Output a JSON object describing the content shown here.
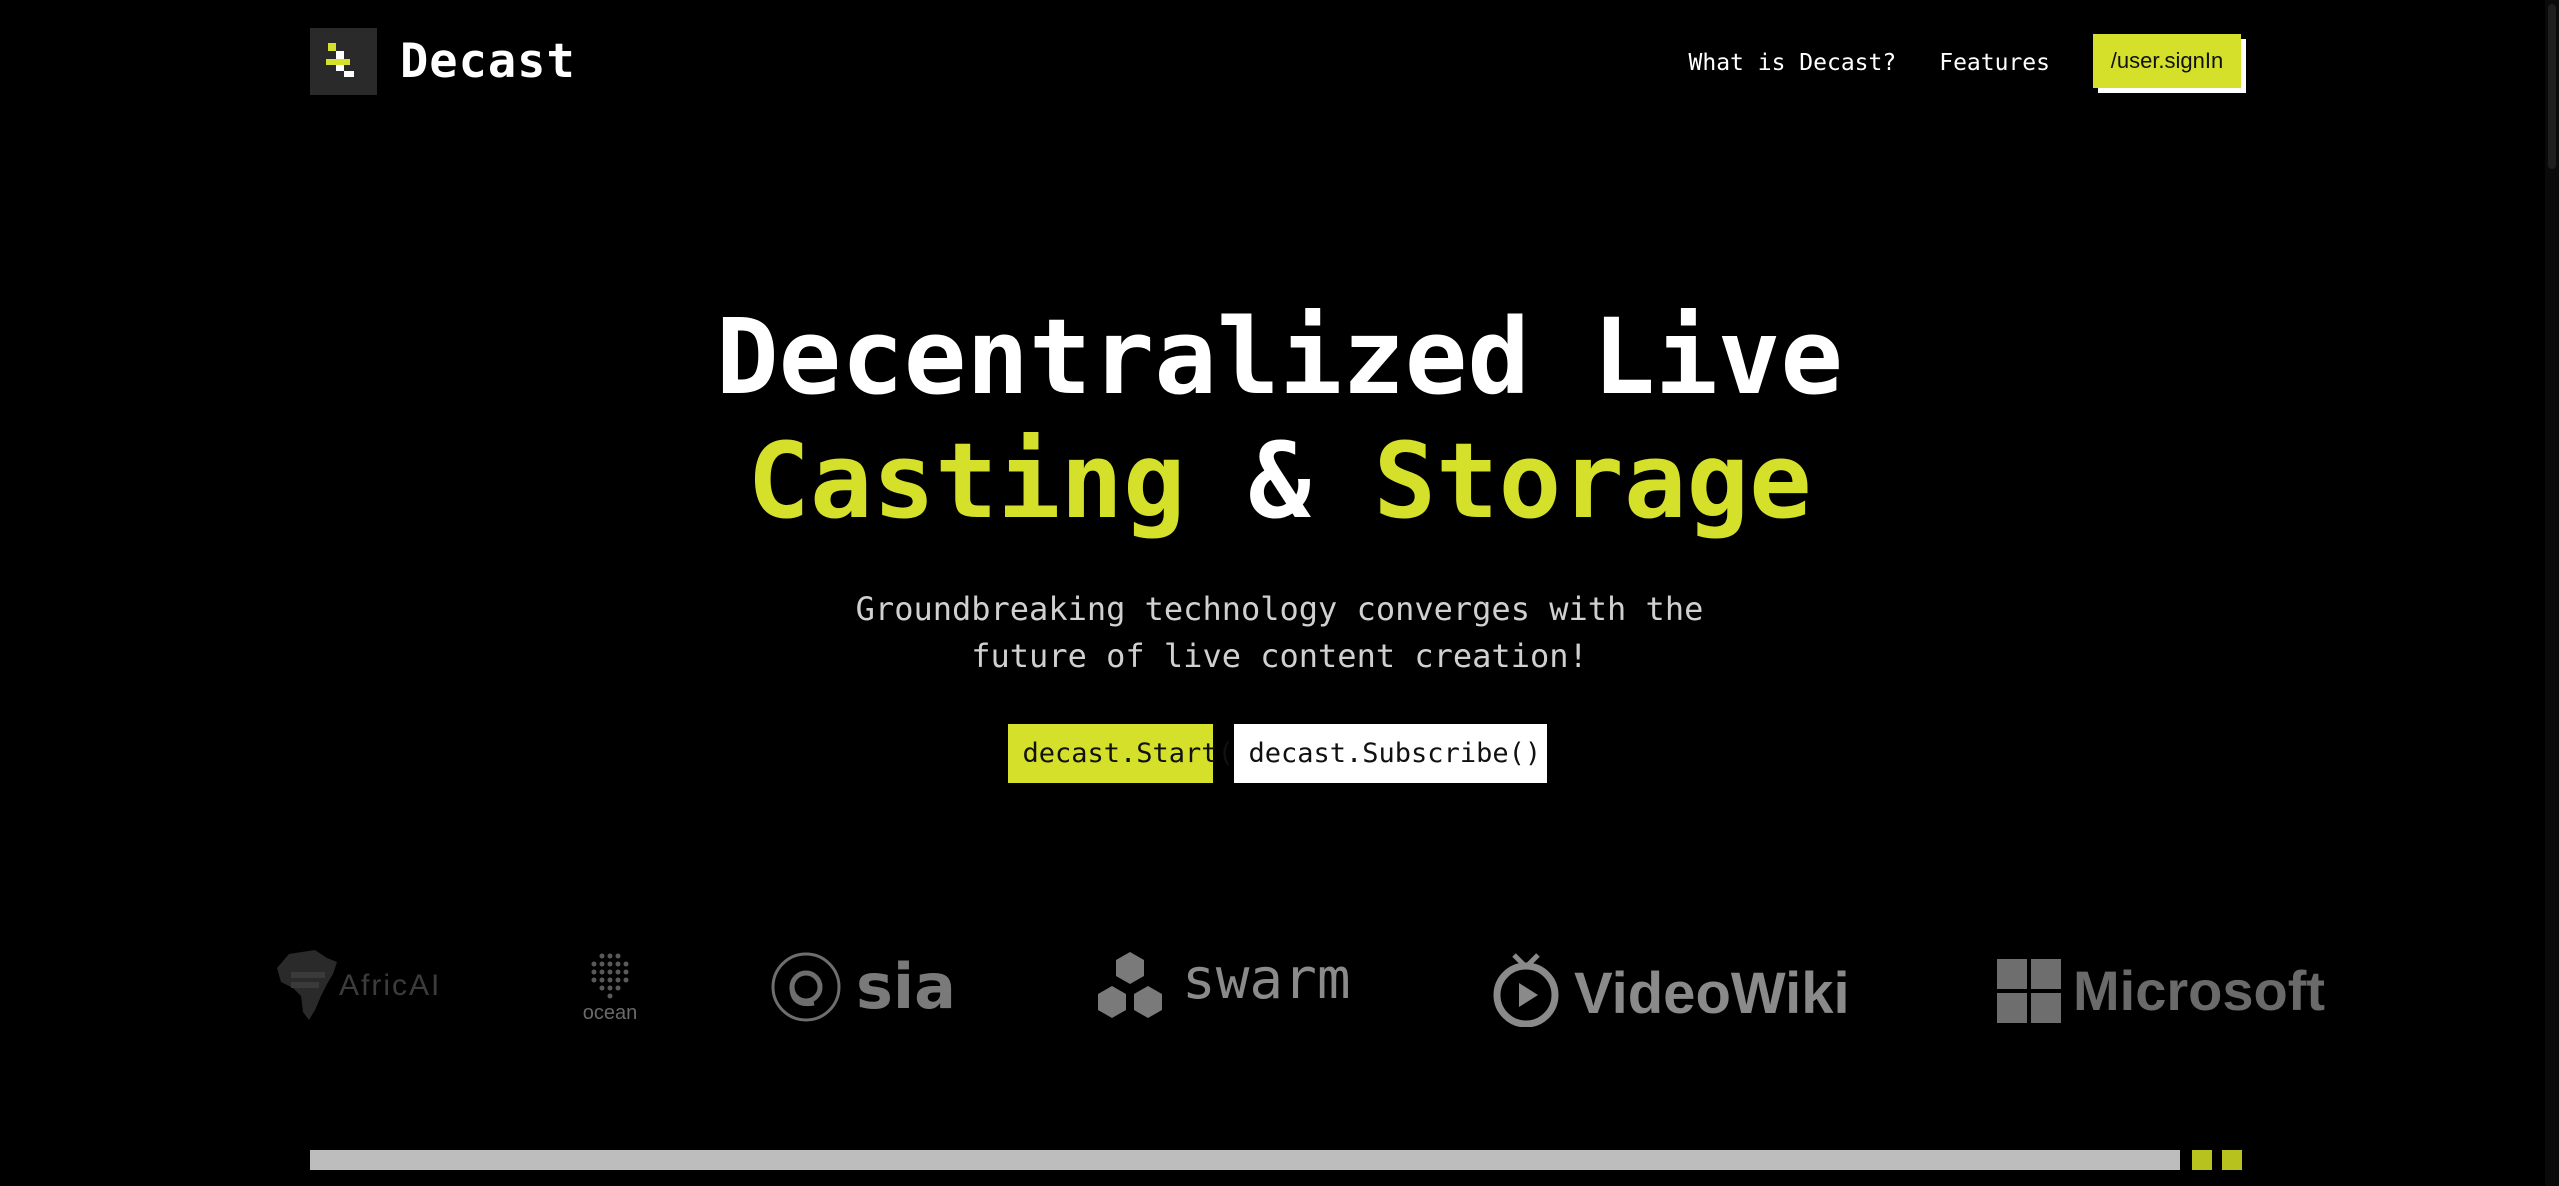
{
  "brand": {
    "name": "Decast"
  },
  "nav": {
    "links": [
      "What is Decast?",
      "Features"
    ],
    "signin_label": "/user.signIn"
  },
  "hero": {
    "title_line1": "Decentralized Live",
    "title_word_a": "Casting",
    "title_amp": "&",
    "title_word_b": "Storage",
    "subtitle_line1": "Groundbreaking technology converges with the",
    "subtitle_line2": "future of live content creation!",
    "start_label": "decast.Start()",
    "subscribe_label": "decast.Subscribe()"
  },
  "partners": {
    "africai": "AfricAI",
    "ocean": "ocean",
    "sia": "sia",
    "swarm": "swarm",
    "videowiki": "VideoWiki",
    "microsoft": "Microsoft"
  },
  "colors": {
    "accent": "#d4e02a",
    "background": "#000000",
    "text": "#ffffff"
  }
}
